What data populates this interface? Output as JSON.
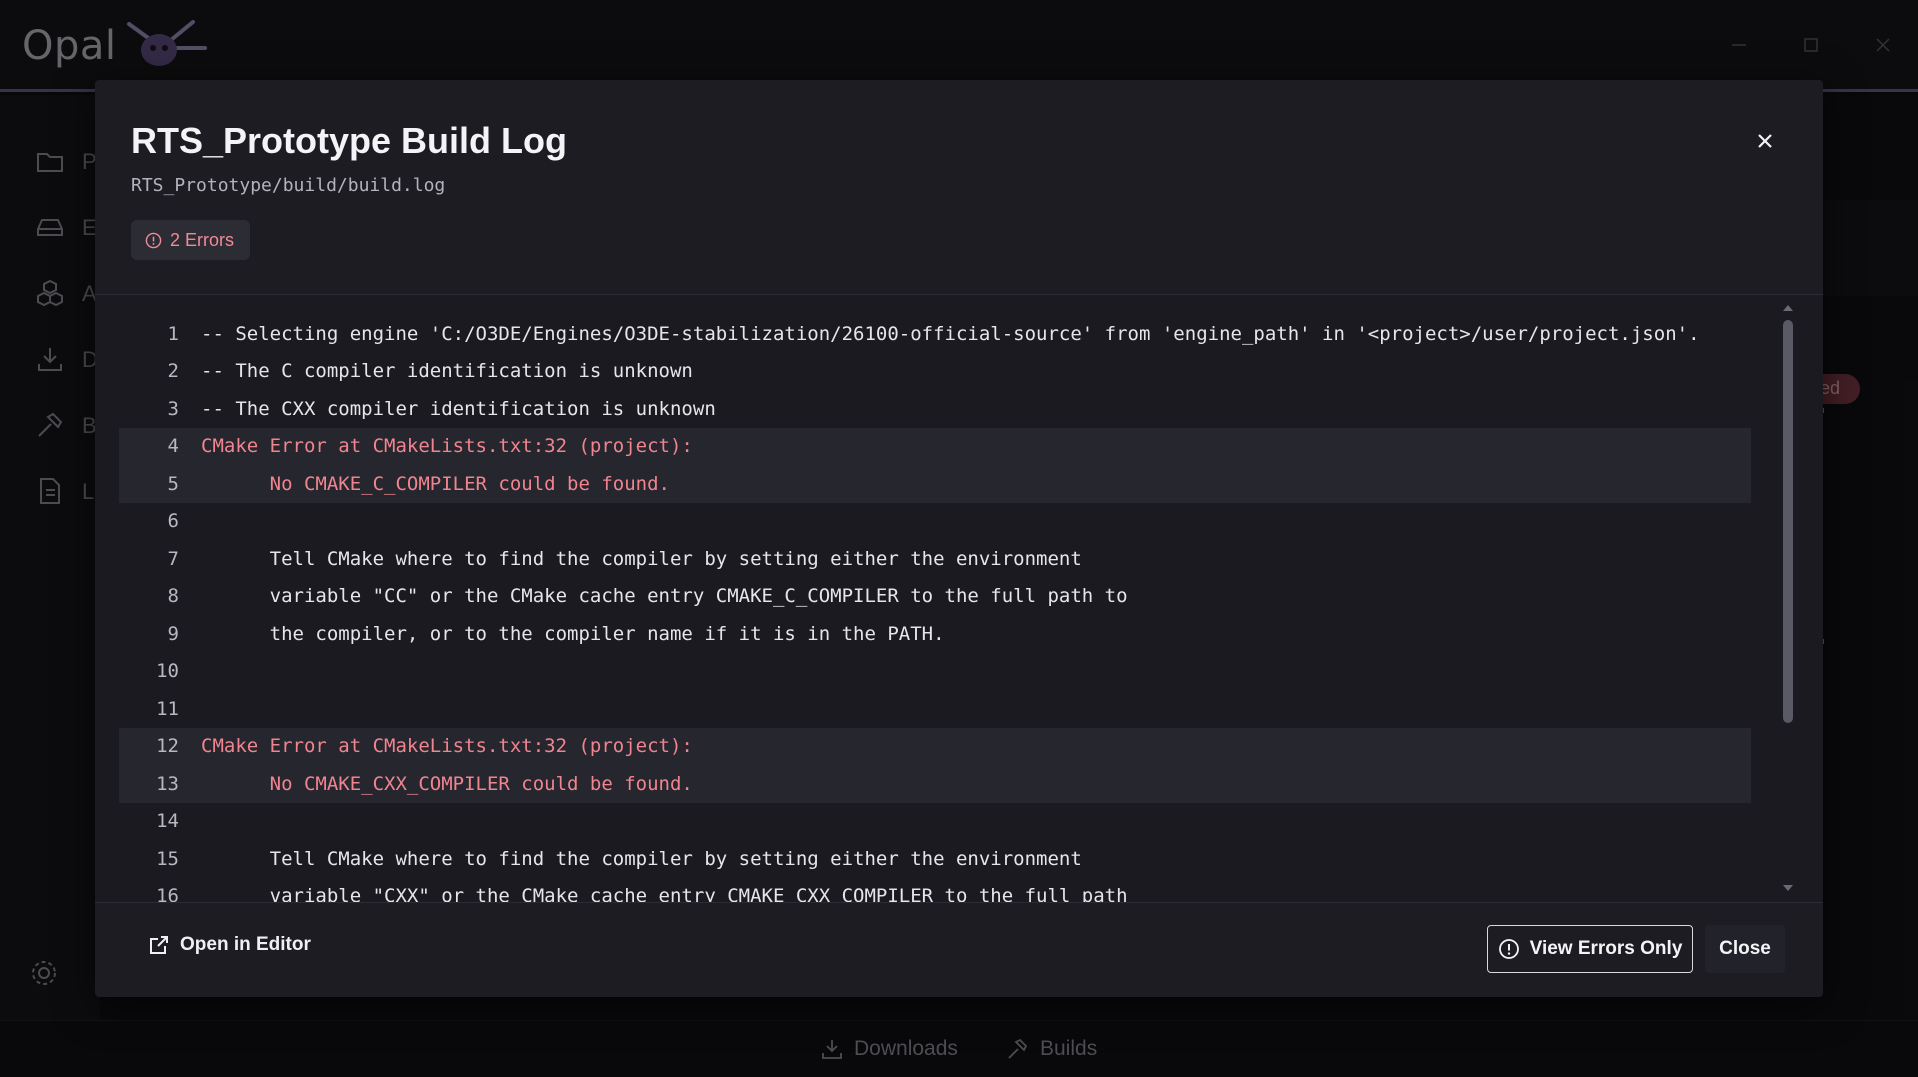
{
  "app": {
    "name": "Opal",
    "sidebar_letters": [
      "P",
      "E",
      "A",
      "D",
      "B",
      "L"
    ],
    "background_badge": "ed",
    "bottom_bar": {
      "downloads": "Downloads",
      "builds": "Builds"
    }
  },
  "modal": {
    "title": "RTS_Prototype Build Log",
    "path": "RTS_Prototype/build/build.log",
    "error_badge": "2 Errors",
    "open_in_editor": "Open in Editor",
    "view_errors_only": "View Errors Only",
    "close": "Close"
  },
  "log": [
    {
      "n": "1",
      "text": "-- Selecting engine 'C:/O3DE/Engines/O3DE-stabilization/26100-official-source' from 'engine_path' in '<project>/user/project.json'.",
      "error": false
    },
    {
      "n": "2",
      "text": "-- The C compiler identification is unknown",
      "error": false
    },
    {
      "n": "3",
      "text": "-- The CXX compiler identification is unknown",
      "error": false
    },
    {
      "n": "4",
      "text": "CMake Error at CMakeLists.txt:32 (project):",
      "error": true
    },
    {
      "n": "5",
      "text": "      No CMAKE_C_COMPILER could be found.",
      "error": true
    },
    {
      "n": "6",
      "text": "",
      "error": false
    },
    {
      "n": "7",
      "text": "      Tell CMake where to find the compiler by setting either the environment",
      "error": false
    },
    {
      "n": "8",
      "text": "      variable \"CC\" or the CMake cache entry CMAKE_C_COMPILER to the full path to",
      "error": false
    },
    {
      "n": "9",
      "text": "      the compiler, or to the compiler name if it is in the PATH.",
      "error": false
    },
    {
      "n": "10",
      "text": "",
      "error": false
    },
    {
      "n": "11",
      "text": "",
      "error": false
    },
    {
      "n": "12",
      "text": "CMake Error at CMakeLists.txt:32 (project):",
      "error": true
    },
    {
      "n": "13",
      "text": "      No CMAKE_CXX_COMPILER could be found.",
      "error": true
    },
    {
      "n": "14",
      "text": "",
      "error": false
    },
    {
      "n": "15",
      "text": "      Tell CMake where to find the compiler by setting either the environment",
      "error": false
    },
    {
      "n": "16",
      "text": "      variable \"CXX\" or the CMake cache entry CMAKE_CXX_COMPILER to the full path",
      "error": false
    }
  ],
  "colors": {
    "accent": "#6a5c86",
    "error_text": "#f0848f",
    "error_row": "#26262e",
    "modal_bg": "#1c1c22"
  }
}
